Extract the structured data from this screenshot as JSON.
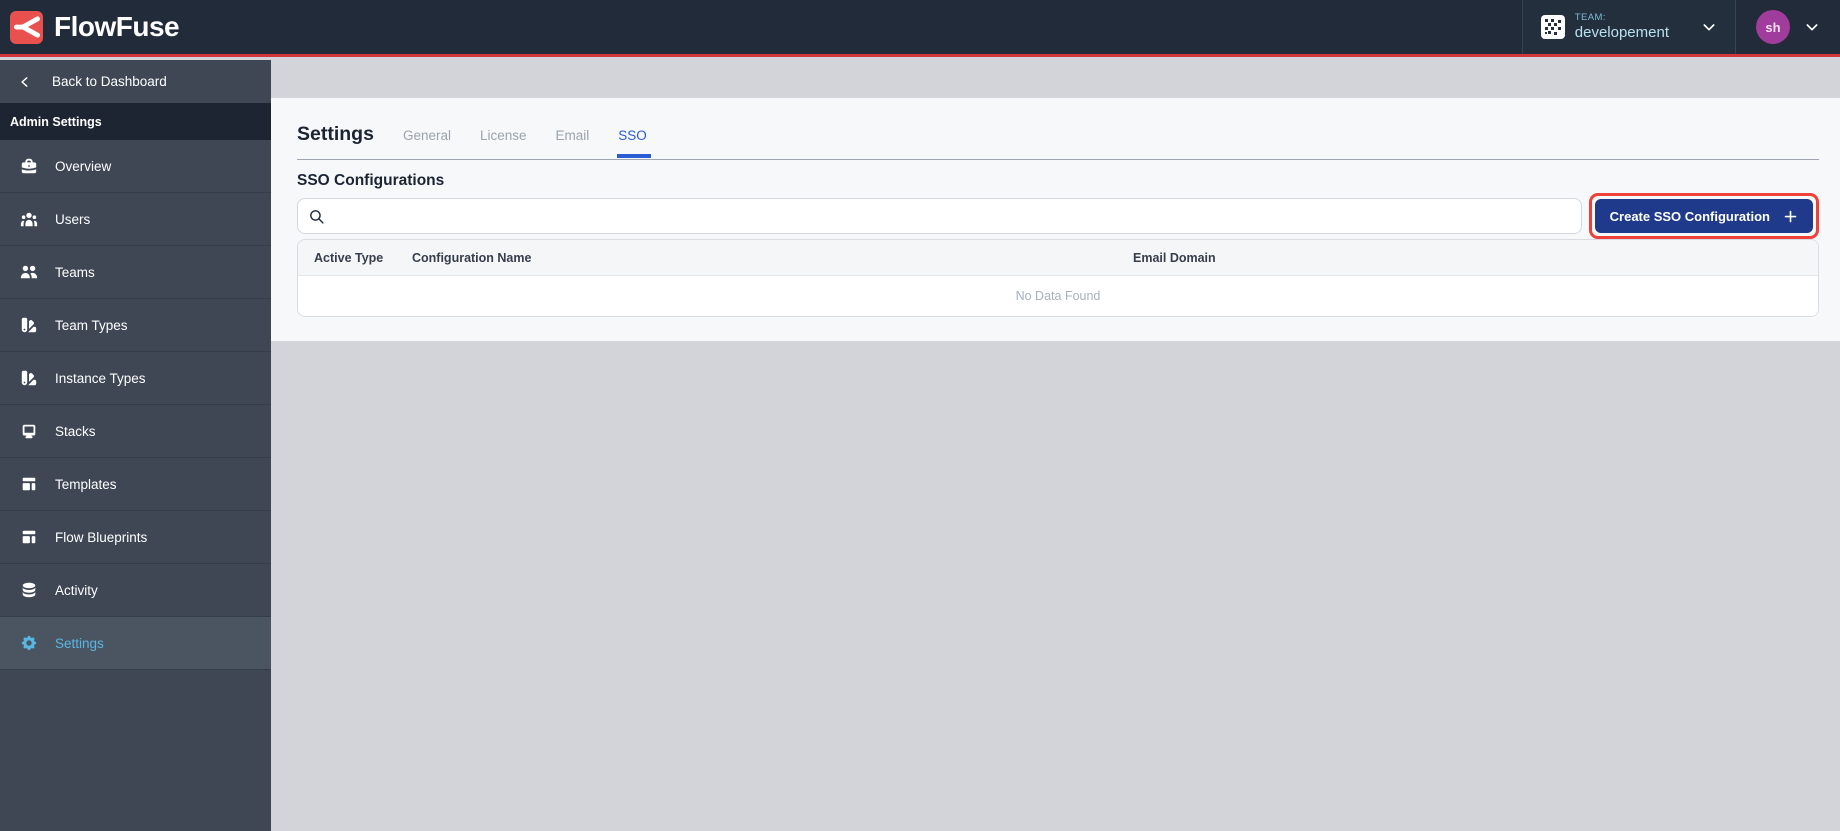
{
  "topbar": {
    "brand": "FlowFuse",
    "team": {
      "label": "TEAM:",
      "name": "developement"
    },
    "avatar_initials": "sh"
  },
  "sidebar": {
    "back_label": "Back to Dashboard",
    "section_label": "Admin Settings",
    "items": [
      {
        "label": "Overview",
        "icon": "briefcase-icon",
        "active": false
      },
      {
        "label": "Users",
        "icon": "users-icon",
        "active": false
      },
      {
        "label": "Teams",
        "icon": "user-group-icon",
        "active": false
      },
      {
        "label": "Team Types",
        "icon": "color-swatch-icon",
        "active": false
      },
      {
        "label": "Instance Types",
        "icon": "color-swatch-icon",
        "active": false
      },
      {
        "label": "Stacks",
        "icon": "desktop-icon",
        "active": false
      },
      {
        "label": "Templates",
        "icon": "template-icon",
        "active": false
      },
      {
        "label": "Flow Blueprints",
        "icon": "template-icon",
        "active": false
      },
      {
        "label": "Activity",
        "icon": "database-icon",
        "active": false
      },
      {
        "label": "Settings",
        "icon": "cog-icon",
        "active": true
      }
    ]
  },
  "main": {
    "title": "Settings",
    "tabs": [
      {
        "label": "General",
        "active": false
      },
      {
        "label": "License",
        "active": false
      },
      {
        "label": "Email",
        "active": false
      },
      {
        "label": "SSO",
        "active": true
      }
    ],
    "section_title": "SSO Configurations",
    "search": {
      "value": "",
      "placeholder": ""
    },
    "create_button_label": "Create SSO Configuration",
    "table": {
      "columns": [
        "Active",
        "Type",
        "Configuration Name",
        "Email Domain"
      ],
      "rows": [],
      "empty_text": "No Data Found"
    }
  },
  "colors": {
    "brand_red": "#e8514e",
    "topbar_underline_red": "#d3353c",
    "button_navy": "#1f3a8a",
    "annotation_red": "#f0403a",
    "active_tab_blue": "#2a5cd3",
    "sidebar_active_blue": "#58b7e2",
    "avatar_purple": "#a03c9b"
  }
}
